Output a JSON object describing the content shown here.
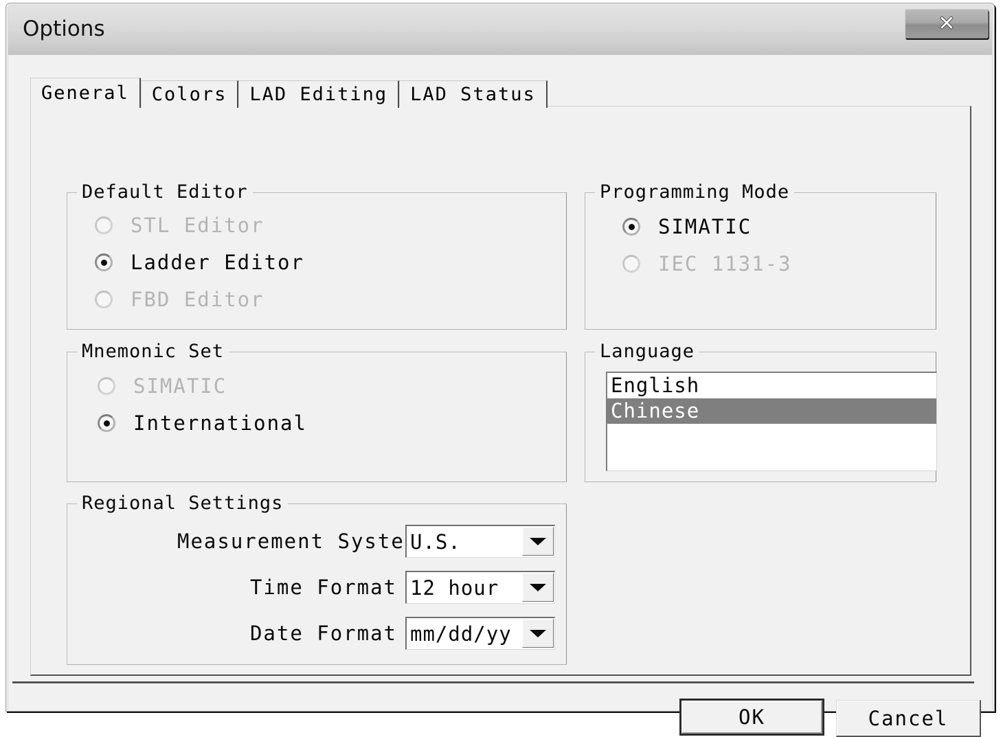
{
  "window": {
    "title": "Options",
    "close_label": "✕"
  },
  "tabs": [
    {
      "label": "General",
      "active": true
    },
    {
      "label": "Colors",
      "active": false
    },
    {
      "label": "LAD Editing",
      "active": false
    },
    {
      "label": "LAD Status",
      "active": false
    }
  ],
  "groups": {
    "default_editor": {
      "label": "Default Editor",
      "options": [
        {
          "label": "STL Editor",
          "selected": false,
          "disabled": true
        },
        {
          "label": "Ladder Editor",
          "selected": true,
          "disabled": false
        },
        {
          "label": "FBD Editor",
          "selected": false,
          "disabled": true
        }
      ]
    },
    "programming_mode": {
      "label": "Programming Mode",
      "options": [
        {
          "label": "SIMATIC",
          "selected": true,
          "disabled": false
        },
        {
          "label": "IEC 1131-3",
          "selected": false,
          "disabled": true
        }
      ]
    },
    "mnemonic_set": {
      "label": "Mnemonic Set",
      "options": [
        {
          "label": "SIMATIC",
          "selected": false,
          "disabled": true
        },
        {
          "label": "International",
          "selected": true,
          "disabled": false
        }
      ]
    },
    "language": {
      "label": "Language",
      "items": [
        {
          "label": "English",
          "selected": false
        },
        {
          "label": "Chinese",
          "selected": true
        }
      ]
    },
    "regional_settings": {
      "label": "Regional Settings",
      "fields": [
        {
          "label": "Measurement System",
          "value": "U.S."
        },
        {
          "label": "Time Format",
          "value": "12 hour"
        },
        {
          "label": "Date Format",
          "value": "mm/dd/yy"
        }
      ]
    }
  },
  "footer": {
    "ok_label": "OK",
    "cancel_label": "Cancel"
  },
  "colors": {
    "dialog_face": "#f1f1f1",
    "selection": "#7f7f7f",
    "disabled_text": "#b4b4b4",
    "text": "#0a0a0a"
  }
}
